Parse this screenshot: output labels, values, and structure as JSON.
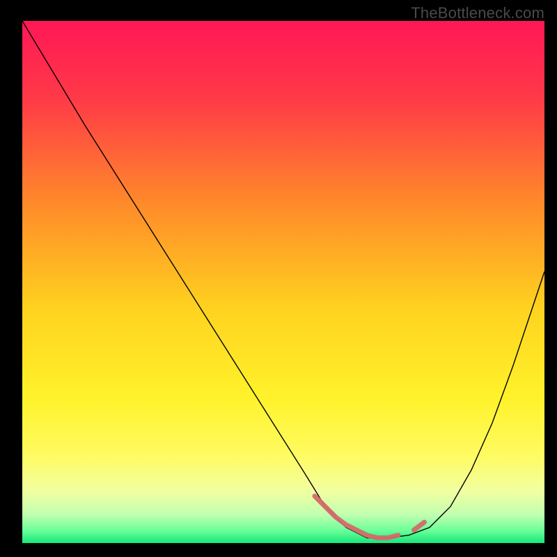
{
  "watermark": "TheBottleneck.com",
  "chart_data": {
    "type": "line",
    "title": "",
    "xlabel": "",
    "ylabel": "",
    "xlim": [
      0,
      100
    ],
    "ylim": [
      0,
      100
    ],
    "grid": false,
    "legend": false,
    "series": [
      {
        "name": "bottleneck-curve",
        "x": [
          0,
          6,
          12,
          18,
          24,
          30,
          36,
          42,
          48,
          54,
          58,
          62,
          66,
          68,
          70,
          74,
          78,
          82,
          86,
          90,
          94,
          100
        ],
        "y": [
          100,
          90,
          80,
          70.5,
          61,
          51.5,
          42,
          32.5,
          23,
          13.5,
          7,
          3,
          1,
          1,
          1,
          1.5,
          3,
          7,
          14,
          23,
          34,
          52
        ],
        "stroke": "#000000",
        "stroke_width": 1.4
      },
      {
        "name": "optimum-markers",
        "x": [
          56,
          58,
          60,
          62,
          64,
          66,
          68,
          70,
          72,
          75,
          77
        ],
        "y": [
          9,
          7,
          5,
          3.5,
          2.5,
          1.5,
          1,
          1,
          1.5,
          2.5,
          4
        ],
        "stroke": "#d46a6a",
        "stroke_width": 7,
        "segments": [
          {
            "range": [
              56,
              72
            ]
          },
          {
            "range": [
              75,
              77
            ]
          }
        ]
      }
    ],
    "background_gradient": {
      "stops": [
        {
          "offset": 0.0,
          "color": "#ff1756"
        },
        {
          "offset": 0.15,
          "color": "#ff3a47"
        },
        {
          "offset": 0.35,
          "color": "#ff8a2a"
        },
        {
          "offset": 0.55,
          "color": "#ffd21f"
        },
        {
          "offset": 0.72,
          "color": "#fff22a"
        },
        {
          "offset": 0.83,
          "color": "#fffb60"
        },
        {
          "offset": 0.9,
          "color": "#f2ffa0"
        },
        {
          "offset": 0.945,
          "color": "#c2ffb0"
        },
        {
          "offset": 0.975,
          "color": "#6eff9a"
        },
        {
          "offset": 1.0,
          "color": "#16e87a"
        }
      ]
    }
  }
}
